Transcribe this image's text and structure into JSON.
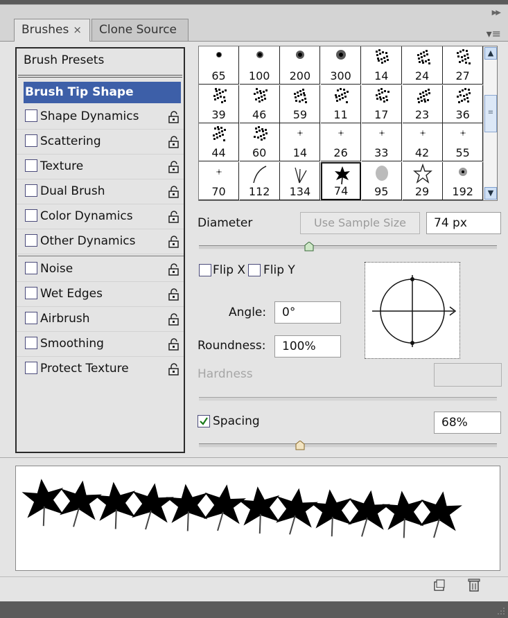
{
  "tabs": [
    {
      "label": "Brushes",
      "close": "×"
    },
    {
      "label": "Clone Source"
    }
  ],
  "options": {
    "presets_label": "Brush Presets",
    "selected_label": "Brush Tip Shape",
    "group1": [
      "Shape Dynamics",
      "Scattering",
      "Texture",
      "Dual Brush",
      "Color Dynamics",
      "Other Dynamics"
    ],
    "group2": [
      "Noise",
      "Wet Edges",
      "Airbrush",
      "Smoothing",
      "Protect Texture"
    ]
  },
  "brush_grid": {
    "rows": [
      [
        "65",
        "100",
        "200",
        "300",
        "14",
        "24",
        "27"
      ],
      [
        "39",
        "46",
        "59",
        "11",
        "17",
        "23",
        "36"
      ],
      [
        "44",
        "60",
        "14",
        "26",
        "33",
        "42",
        "55"
      ],
      [
        "70",
        "112",
        "134",
        "74",
        "95",
        "29",
        "192"
      ]
    ],
    "selected": "74"
  },
  "controls": {
    "diameter_label": "Diameter",
    "sample_button": "Use Sample Size",
    "diameter_value": "74 px",
    "diameter_slider": 0.37,
    "flip_x": "Flip X",
    "flip_y": "Flip Y",
    "angle_label": "Angle:",
    "angle_value": "0°",
    "roundness_label": "Roundness:",
    "roundness_value": "100%",
    "hardness_label": "Hardness",
    "spacing_label": "Spacing",
    "spacing_checked": true,
    "spacing_value": "68%",
    "spacing_slider": 0.34
  },
  "colors": {
    "selection": "#3d5fa8",
    "check": "#1a7a1a"
  }
}
